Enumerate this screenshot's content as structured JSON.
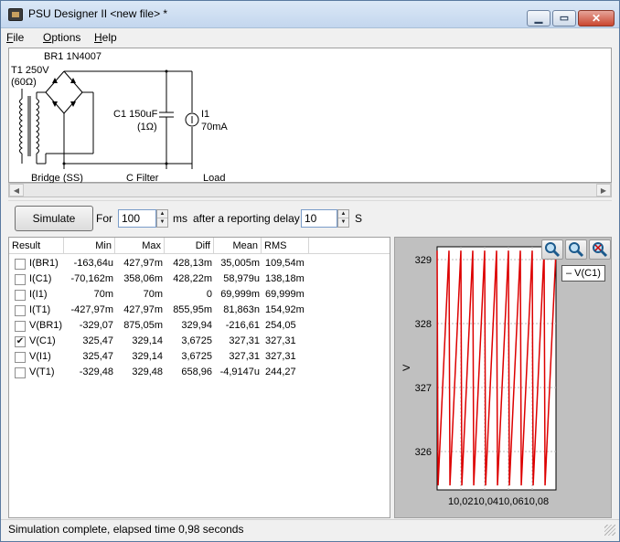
{
  "window": {
    "title": "PSU Designer II  <new file> *",
    "min_glyph": "▁",
    "max_glyph": "▭",
    "close_glyph": "✕"
  },
  "menu": {
    "file": {
      "ul": "F",
      "rest": "ile"
    },
    "options": {
      "ul": "O",
      "rest": "ptions"
    },
    "help": {
      "ul": "H",
      "rest": "elp"
    }
  },
  "schematic": {
    "bridge_part": "BR1 1N4007",
    "transformer_name": "T1 250V",
    "transformer_res": "(60Ω)",
    "cap_name": "C1 150uF",
    "cap_res": "(1Ω)",
    "load_name": "I1",
    "load_value": "70mA",
    "stage_bridge": "Bridge (SS)",
    "stage_filter": "C Filter",
    "stage_load": "Load"
  },
  "toolbar": {
    "simulate_label": "Simulate",
    "for_label": "For",
    "duration_value": "100",
    "duration_unit": "ms",
    "delay_label": "after a reporting delay of",
    "delay_value": "10",
    "delay_unit": "S"
  },
  "results": {
    "columns": [
      "Result",
      "Min",
      "Max",
      "Diff",
      "Mean",
      "RMS"
    ],
    "rows": [
      {
        "name": "I(BR1)",
        "checked": false,
        "min": "-163,64u",
        "max": "427,97m",
        "diff": "428,13m",
        "mean": "35,005m",
        "rms": "109,54m"
      },
      {
        "name": "I(C1)",
        "checked": false,
        "min": "-70,162m",
        "max": "358,06m",
        "diff": "428,22m",
        "mean": "58,979u",
        "rms": "138,18m"
      },
      {
        "name": "I(I1)",
        "checked": false,
        "min": "70m",
        "max": "70m",
        "diff": "0",
        "mean": "69,999m",
        "rms": "69,999m"
      },
      {
        "name": "I(T1)",
        "checked": false,
        "min": "-427,97m",
        "max": "427,97m",
        "diff": "855,95m",
        "mean": "81,863n",
        "rms": "154,92m"
      },
      {
        "name": "V(BR1)",
        "checked": false,
        "min": "-329,07",
        "max": "875,05m",
        "diff": "329,94",
        "mean": "-216,61",
        "rms": "254,05"
      },
      {
        "name": "V(C1)",
        "checked": true,
        "min": "325,47",
        "max": "329,14",
        "diff": "3,6725",
        "mean": "327,31",
        "rms": "327,31"
      },
      {
        "name": "V(I1)",
        "checked": false,
        "min": "325,47",
        "max": "329,14",
        "diff": "3,6725",
        "mean": "327,31",
        "rms": "327,31"
      },
      {
        "name": "V(T1)",
        "checked": false,
        "min": "-329,48",
        "max": "329,48",
        "diff": "658,96",
        "mean": "-4,9147u",
        "rms": "244,27"
      }
    ]
  },
  "plot": {
    "tooltip": "– V(C1)",
    "ylabel": "V",
    "yticks": [
      "329",
      "328",
      "327",
      "326"
    ],
    "xtick_text": "10,0210,0410,0610,08",
    "trace_color": "#dd0000",
    "background": "#ffffff",
    "panel_color": "#c0c0c0"
  },
  "chart_data": {
    "type": "line",
    "title": "",
    "xlabel": "",
    "ylabel": "V",
    "ylim": [
      325.4,
      329.2
    ],
    "xlim": [
      10.0,
      10.1
    ],
    "grid": true,
    "series": [
      {
        "name": "V(C1)",
        "ripple_min": 325.47,
        "ripple_max": 329.14,
        "x": [
          10.0,
          10.0008,
          10.01,
          10.0108,
          10.02,
          10.0208,
          10.03,
          10.0308,
          10.04,
          10.0408,
          10.05,
          10.0508,
          10.06,
          10.0608,
          10.07,
          10.0708,
          10.08,
          10.0808,
          10.09,
          10.0908,
          10.1
        ],
        "values": [
          329.14,
          325.47,
          329.14,
          325.47,
          329.14,
          325.47,
          329.14,
          325.47,
          329.14,
          325.47,
          329.14,
          325.47,
          329.14,
          325.47,
          329.14,
          325.47,
          329.14,
          325.47,
          329.14,
          325.47,
          329.14
        ]
      }
    ]
  },
  "status": {
    "text": "Simulation complete, elapsed time 0,98 seconds"
  }
}
